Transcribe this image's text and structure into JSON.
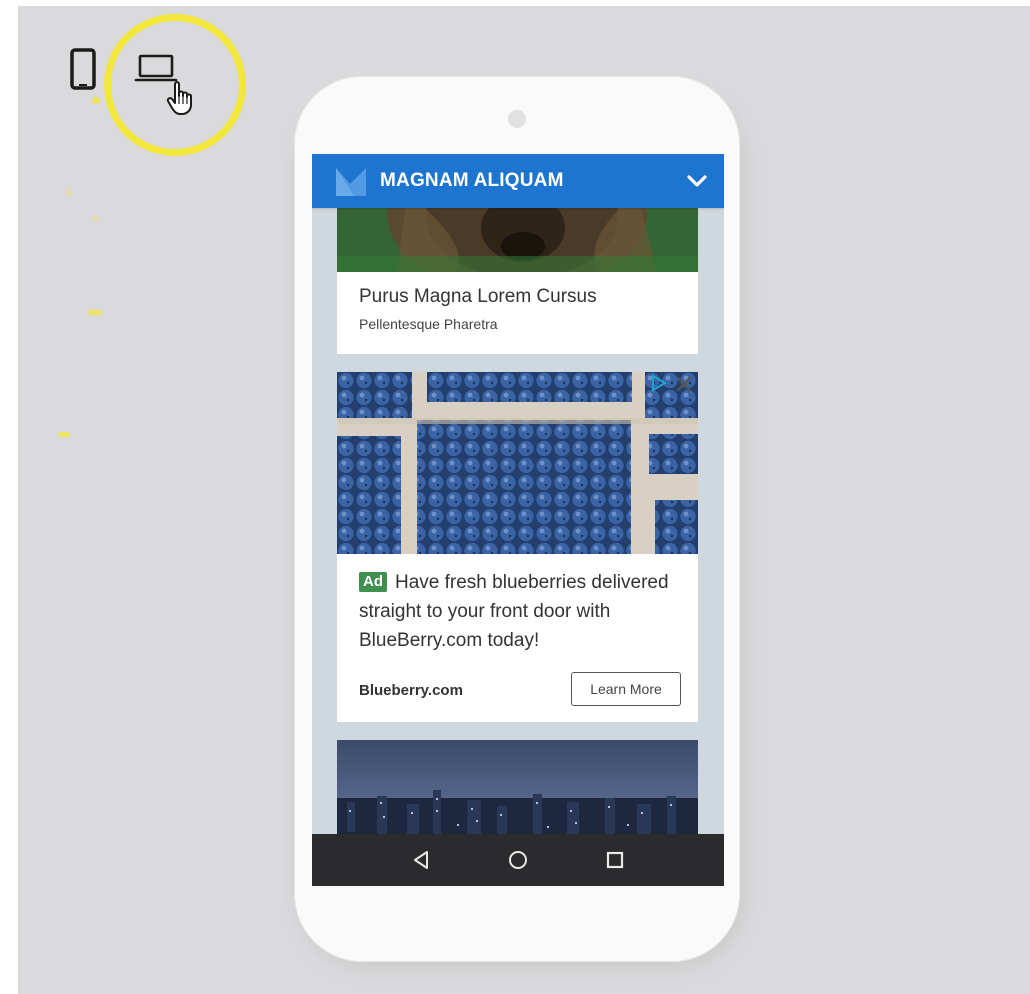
{
  "app": {
    "title": "MAGNAM ALIQUAM"
  },
  "article": {
    "title": "Purus Magna Lorem Cursus",
    "subtitle": "Pellentesque Pharetra"
  },
  "ad": {
    "badge": "Ad",
    "body": "Have fresh blueberries delivered straight to your front door with BlueBerry.com today!",
    "domain": "Blueberry.com",
    "cta_label": "Learn More"
  },
  "icons": {
    "phone_toggle": "smartphone-icon",
    "laptop_toggle": "laptop-icon",
    "cursor": "hand-pointer-icon",
    "header_menu": "chevron-down-icon",
    "ad_info": "adchoices-icon",
    "ad_close": "close-icon",
    "nav_back": "back-triangle-icon",
    "nav_home": "home-circle-icon",
    "nav_recents": "recents-square-icon"
  },
  "colors": {
    "header": "#1e75d0",
    "ad_badge": "#3e8f50",
    "highlight_ring": "#f2e73a",
    "nav_bar": "#2b2b2d",
    "background": "#dadadc"
  }
}
